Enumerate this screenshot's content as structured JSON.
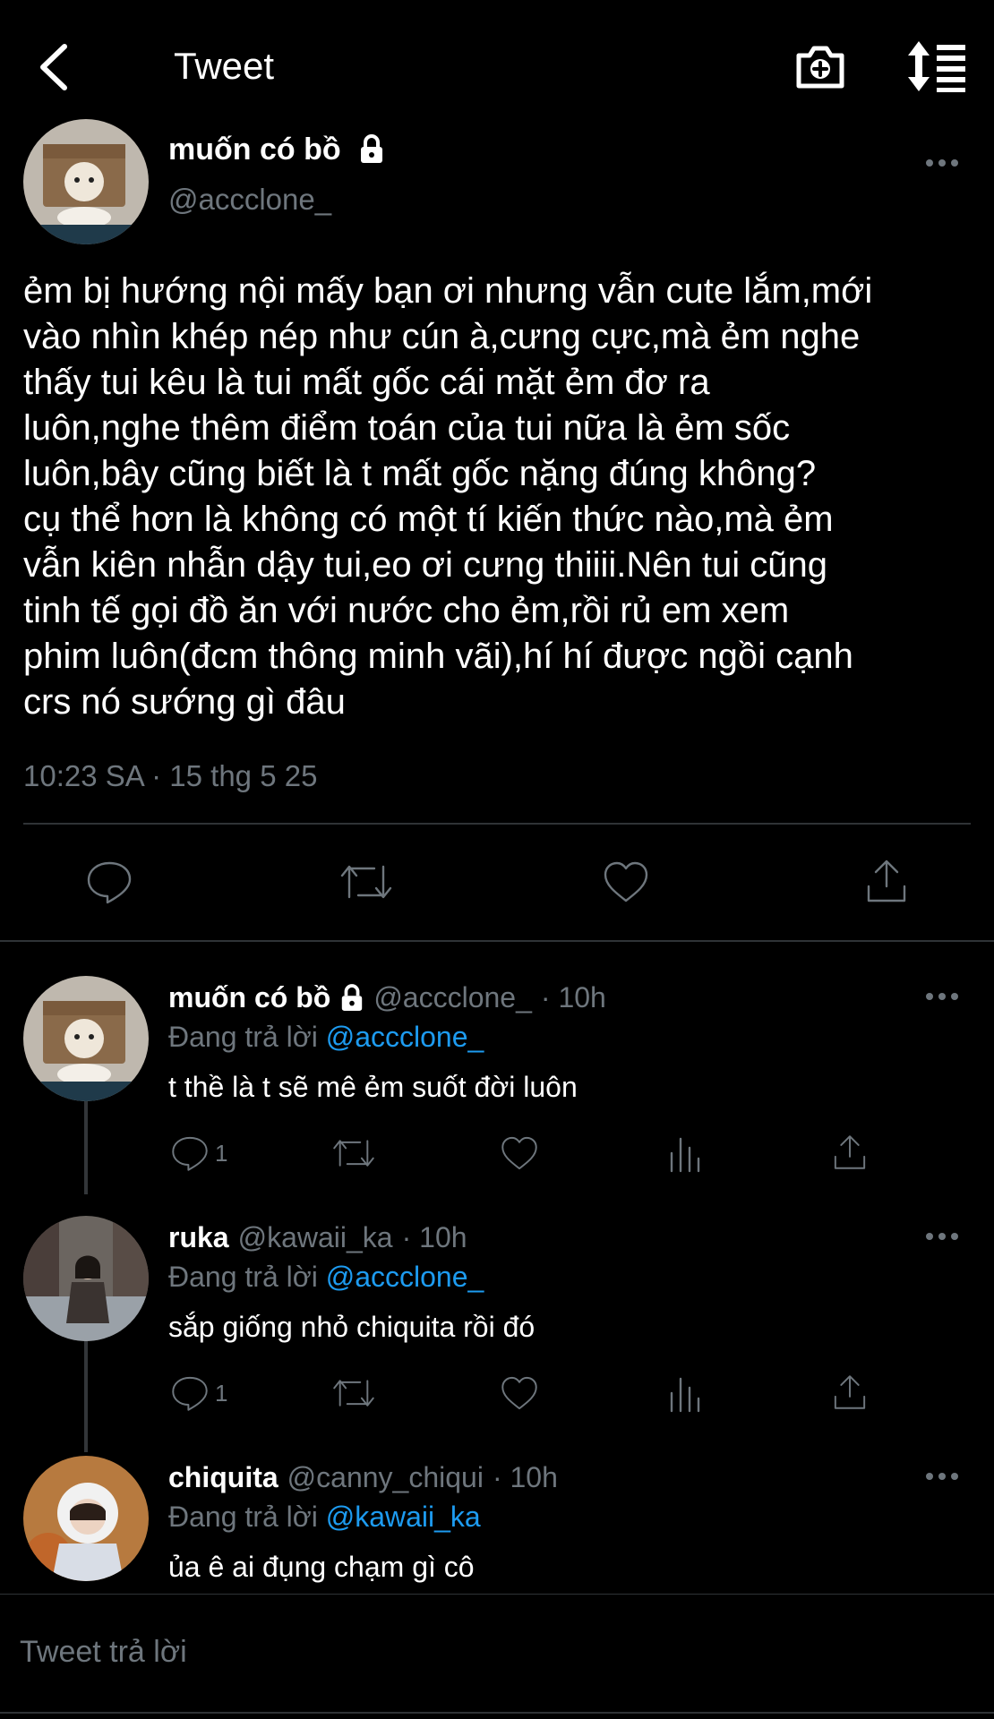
{
  "header": {
    "title": "Tweet"
  },
  "main_tweet": {
    "display_name": "muốn có bồ",
    "handle": "@accclone_",
    "text": "ẻm bị hướng nội mấy bạn ơi nhưng vẫn cute lắm,mới\nvào nhìn khép nép như cún à,cưng cực,mà ẻm nghe\nthấy tui kêu là tui mất gốc cái mặt ẻm đơ ra\nluôn,nghe thêm điểm toán của tui nữa là ẻm sốc\nluôn,bây cũng biết là t mất gốc nặng đúng không?\ncụ thể hơn là không có một tí kiến thức nào,mà ẻm\nvẫn kiên nhẫn dậy tui,eo ơi cưng thiiii.Nên tui cũng\ntinh tế gọi đồ ăn với nước cho ẻm,rồi rủ em xem\nphim luôn(đcm thông minh vãi),hí hí được ngồi cạnh\ncrs nó sướng gì đâu",
    "timestamp": "10:23 SA · 15 thg 5 25"
  },
  "replies": [
    {
      "display_name": "muốn có bồ",
      "handle": "@accclone_",
      "time": "· 10h",
      "replying_label": "Đang trả lời",
      "replying_to": "@accclone_",
      "text": "t thề là t sẽ mê ẻm suốt đời luôn",
      "reply_count": "1"
    },
    {
      "display_name": "ruka",
      "handle": "@kawaii_ka",
      "time": "· 10h",
      "replying_label": "Đang trả lời",
      "replying_to": "@accclone_",
      "text": "sắp giống nhỏ chiquita rồi đó",
      "reply_count": "1"
    },
    {
      "display_name": "chiquita",
      "handle": "@canny_chiqui",
      "time": "· 10h",
      "replying_label": "Đang trả lời",
      "replying_to": "@kawaii_ka",
      "text": "ủa ê ai đụng chạm gì cô"
    }
  ],
  "composer": {
    "placeholder": "Tweet trả lời"
  },
  "colors": {
    "background": "#000000",
    "muted": "#6e767d",
    "link": "#1d9bf0",
    "divider": "#2f3336"
  },
  "icons": [
    "back-arrow-icon",
    "camera-plus-icon",
    "sort-list-icon",
    "lock-icon",
    "more-icon",
    "reply-icon",
    "retweet-icon",
    "like-icon",
    "share-icon",
    "analytics-icon"
  ]
}
